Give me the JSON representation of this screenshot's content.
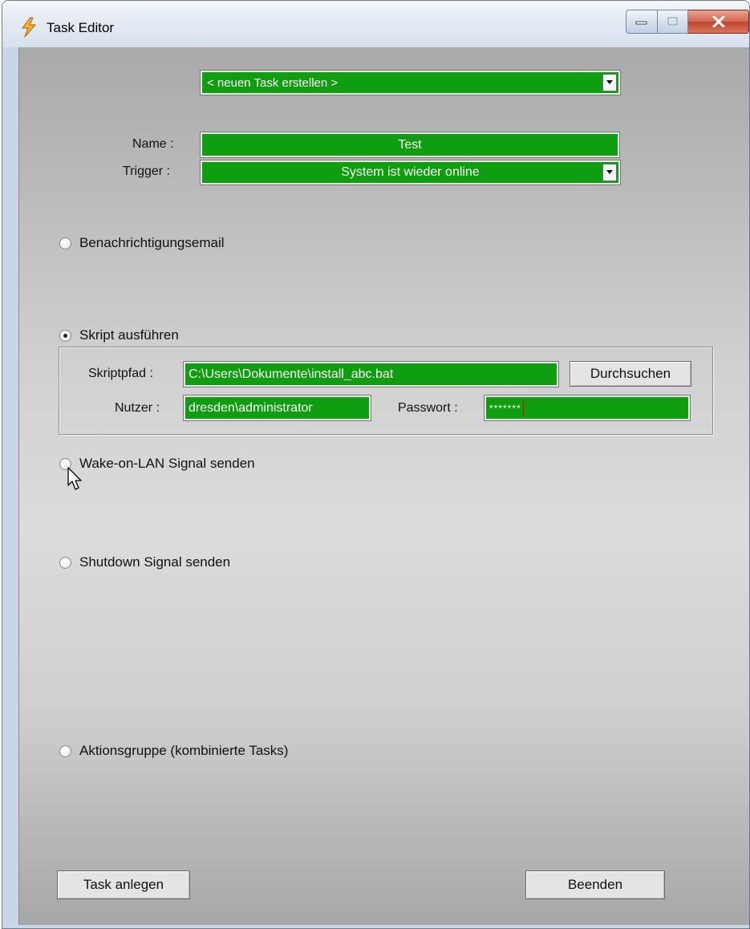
{
  "window": {
    "title": "Task Editor"
  },
  "task_select": {
    "value": "< neuen Task erstellen >"
  },
  "form": {
    "name_label": "Name :",
    "name_value": "Test",
    "trigger_label": "Trigger :",
    "trigger_value": "System ist wieder online"
  },
  "options": {
    "email_label": "Benachrichtigungsemail",
    "script_label": "Skript ausführen",
    "wol_label": "Wake-on-LAN Signal senden",
    "shutdown_label": "Shutdown Signal senden",
    "group_label": "Aktionsgruppe (kombinierte Tasks)",
    "selected": "script"
  },
  "script": {
    "path_label": "Skriptpfad :",
    "path_value": "C:\\Users\\Dokumente\\install_abc.bat",
    "browse_label": "Durchsuchen",
    "user_label": "Nutzer :",
    "user_value": "dresden\\administrator",
    "password_label": "Passwort :",
    "password_value": "*******"
  },
  "footer": {
    "create_label": "Task anlegen",
    "exit_label": "Beenden"
  },
  "colors": {
    "field_green": "#0f9e0f",
    "close_red": "#c0442b"
  },
  "icons": {
    "app": "lightning-bolt-icon",
    "dropdown": "chevron-down-icon",
    "cursor": "mouse-pointer-icon"
  }
}
